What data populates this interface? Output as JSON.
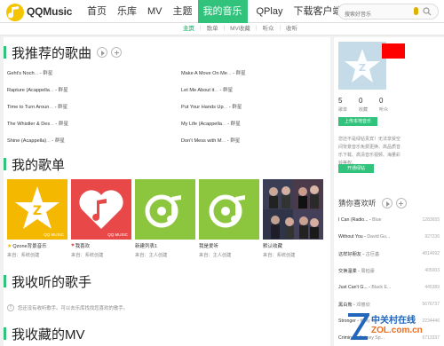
{
  "app": {
    "logo_text": "QQMusic"
  },
  "nav": {
    "items": [
      "首页",
      "乐库",
      "MV",
      "主题",
      "我的音乐",
      "QPlay",
      "下载客户端"
    ],
    "active_index": 4
  },
  "search": {
    "placeholder": "搜索好音乐"
  },
  "subnav": {
    "items": [
      "主页",
      "歌单",
      "MV收藏",
      "听众",
      "收听"
    ],
    "active_index": 0
  },
  "sections": {
    "recommended": "我推荐的歌曲",
    "playlists": "我的歌单",
    "singers": "我收听的歌手",
    "mv": "我收藏的MV"
  },
  "songs": [
    {
      "title": "Geht's Noch",
      "artist": "群星"
    },
    {
      "title": "Make A Move On Me",
      "artist": "群星"
    },
    {
      "title": "Rapture (Acappella",
      "artist": "群星"
    },
    {
      "title": "Let Me About it",
      "artist": "群星"
    },
    {
      "title": "Time to Turn Aroun",
      "artist": "群星"
    },
    {
      "title": "Put Your Hands Up",
      "artist": "群星"
    },
    {
      "title": "The Whistler & Des",
      "artist": "群星"
    },
    {
      "title": "My Life (Acappella",
      "artist": "群星"
    },
    {
      "title": "Shine (Acappella)",
      "artist": "群星"
    },
    {
      "title": "Don't Mess with M",
      "artist": "群星"
    }
  ],
  "song_separator": "...",
  "playlists": [
    {
      "name": "Qzone背景音乐",
      "meta": "来自：系统创建",
      "color": "#f5b800",
      "icon": "star-icon",
      "label": "QQ MUSIC"
    },
    {
      "name": "我喜欢",
      "meta": "来自：系统创建",
      "color": "#e84848",
      "icon": "heart-icon",
      "label": "QQ MUSIC"
    },
    {
      "name": "新建列表1",
      "meta": "来自：主人创建",
      "color": "#8cc63f",
      "icon": "",
      "label": ""
    },
    {
      "name": "我是爱听",
      "meta": "来自：主人创建",
      "color": "#8cc63f",
      "icon": "",
      "label": ""
    },
    {
      "name": "默认收藏",
      "meta": "来自：系统创建",
      "color": "#2a2a3a",
      "icon": "",
      "label": ""
    }
  ],
  "singers_empty": "您还没有收听歌手。可以去乐库找找您喜欢的歌手。",
  "profile": {
    "stats": [
      {
        "value": "5",
        "label": "歌单"
      },
      {
        "value": "0",
        "label": "收藏"
      },
      {
        "value": "0",
        "label": "听众"
      }
    ],
    "upload_label": "上传本地音乐",
    "vip_note": "您还不是绿钻贵宾！无法享受空间背景音乐免费更换、高品质音乐下载、高清音乐视频、海量彩铃等权。",
    "vip_button": "开通绿钻"
  },
  "recent": {
    "title": "猜你喜欢听",
    "items": [
      {
        "song": "I Can (Radio...",
        "artist": "Blue",
        "count": "1283655"
      },
      {
        "song": "Without You",
        "artist": "David Gu...",
        "count": "927236"
      },
      {
        "song": "这样好朋友",
        "artist": "古巨基",
        "count": "4814692"
      },
      {
        "song": "交换温柔",
        "artist": "周柏豪",
        "count": "405003"
      },
      {
        "song": "Just Can't G...",
        "artist": "Black E...",
        "count": "445389"
      },
      {
        "song": "黑白熊",
        "artist": "邓丽欣",
        "count": "5676737"
      },
      {
        "song": "Stronger",
        "artist": "Kelly C...",
        "count": "2234446"
      },
      {
        "song": "Criminal",
        "artist": "Britney Sp...",
        "count": "6713337"
      }
    ]
  },
  "watermark": {
    "line1": "中关村在线",
    "line2": "ZOL.com.cn"
  },
  "colors": {
    "accent": "#31c27c",
    "brand_yellow": "#ddb100",
    "flag": "#ff0000"
  }
}
